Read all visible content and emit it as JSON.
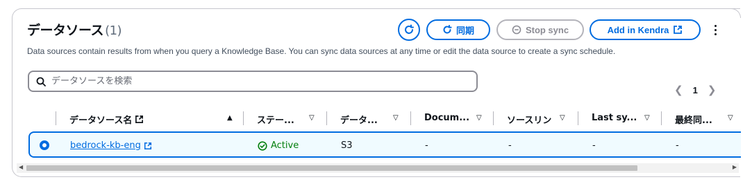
{
  "header": {
    "title": "データソース",
    "count": "(1)",
    "description": "Data sources contain results from when you query a Knowledge Base. You can sync data sources at any time or edit the data source to create a sync schedule."
  },
  "actions": {
    "sync_label": "同期",
    "stop_sync_label": "Stop sync",
    "add_kendra_label": "Add in Kendra"
  },
  "search": {
    "placeholder": "データソースを検索"
  },
  "pagination": {
    "current_page": "1"
  },
  "table": {
    "columns": [
      "データソース名",
      "ステー...",
      "データ...",
      "Docum...",
      "ソースリン",
      "Last sy...",
      "最終同..."
    ],
    "rows": [
      {
        "name": "bedrock-kb-eng",
        "status": "Active",
        "type": "S3",
        "documents": "-",
        "source_link": "-",
        "last_sync": "-",
        "last_sync_jp": "-"
      }
    ]
  },
  "colors": {
    "accent": "#006ce0",
    "success": "#037f0c",
    "border": "#c6c6cd",
    "selected_bg": "#f0fbff"
  }
}
